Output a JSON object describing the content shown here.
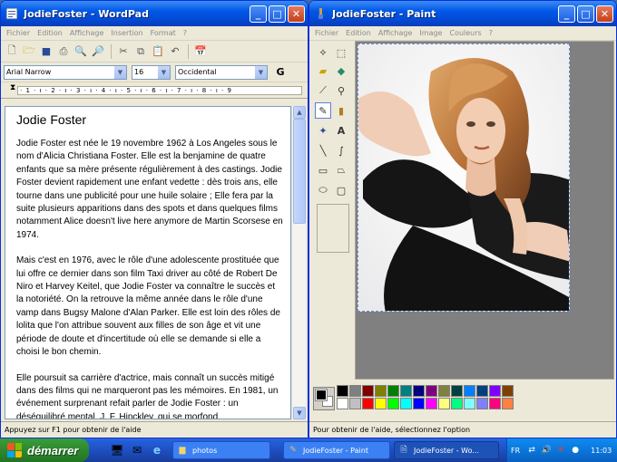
{
  "wordpad": {
    "title": "JodieFoster - WordPad",
    "menu": [
      "Fichier",
      "Edition",
      "Affichage",
      "Insertion",
      "Format",
      "?"
    ],
    "font": "Arial Narrow",
    "size": "16",
    "script": "Occidental",
    "bold_label": "G",
    "ruler": "· 1 · ı · 2 · ı · 3 · ı · 4 · ı · 5 · ı · 6 · ı · 7 · ı · 8 · ı · 9",
    "heading": "Jodie Foster",
    "paragraphs": [
      "Jodie Foster est née le 19 novembre 1962 à Los Angeles sous le nom d'Alicia Christiana Foster. Elle est la benjamine de quatre enfants que sa mère présente régulièrement à des castings. Jodie Foster devient rapidement une enfant vedette : dès trois ans, elle tourne dans une publicité pour une huile solaire ; Elle fera par la suite plusieurs apparitions dans des spots et dans quelques films notamment Alice doesn't live here anymore de Martin Scorsese en 1974.",
      "Mais c'est en 1976, avec le rôle d'une adolescente prostituée que lui offre ce dernier dans son film Taxi driver au côté de Robert De Niro et Harvey Keitel, que Jodie Foster va connaître le succès et la notoriété. On la retrouve la même année dans le rôle d'une vamp dans Bugsy Malone d'Alan Parker. Elle est loin des rôles de lolita que l'on attribue souvent aux filles de son âge et vit une période de doute et d'incertitude où elle se demande si elle a choisi le bon chemin.",
      "Elle poursuit sa carrière d'actrice, mais connaît un succès mitigé dans des films qui ne marqueront pas les mémoires. En 1981, un événement surprenant refait parler de Jodie Foster : un déséquilibré mental, J. F. Hinckley, qui se morfond"
    ],
    "status": "Appuyez sur F1 pour obtenir de l'aide"
  },
  "paint": {
    "title": "JodieFoster - Paint",
    "menu": [
      "Fichier",
      "Edition",
      "Affichage",
      "Image",
      "Couleurs",
      "?"
    ],
    "status": "Pour obtenir de l'aide, sélectionnez l'option",
    "palette": [
      "#000000",
      "#808080",
      "#800000",
      "#808000",
      "#008000",
      "#008080",
      "#000080",
      "#800080",
      "#808040",
      "#004040",
      "#0080ff",
      "#004080",
      "#8000ff",
      "#804000",
      "#ffffff",
      "#c0c0c0",
      "#ff0000",
      "#ffff00",
      "#00ff00",
      "#00ffff",
      "#0000ff",
      "#ff00ff",
      "#ffff80",
      "#00ff80",
      "#80ffff",
      "#8080ff",
      "#ff0080",
      "#ff8040"
    ]
  },
  "taskbar": {
    "start": "démarrer",
    "tasks": [
      "photos",
      "JodieFoster - Paint",
      "JodieFoster - Wo..."
    ],
    "lang": "FR",
    "clock": "11:03"
  }
}
